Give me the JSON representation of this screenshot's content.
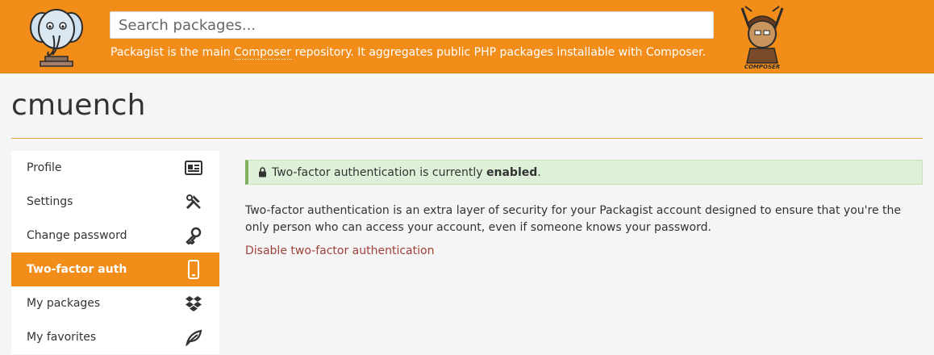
{
  "header": {
    "search_placeholder": "Search packages...",
    "tagline_before": "Packagist is the main ",
    "tagline_link": "Composer",
    "tagline_after": " repository. It aggregates public PHP packages installable with Composer.",
    "composer_logo_text": "COMPOSER",
    "brand_color": "#f28d1a"
  },
  "page": {
    "title": "cmuench"
  },
  "sidebar": {
    "items": [
      {
        "label": "Profile",
        "icon": "id-card-icon",
        "active": false
      },
      {
        "label": "Settings",
        "icon": "tools-icon",
        "active": false
      },
      {
        "label": "Change password",
        "icon": "key-icon",
        "active": false
      },
      {
        "label": "Two-factor auth",
        "icon": "mobile-phone-icon",
        "active": true
      },
      {
        "label": "My packages",
        "icon": "dropbox-icon",
        "active": false
      },
      {
        "label": "My favorites",
        "icon": "leaf-icon",
        "active": false
      }
    ]
  },
  "main": {
    "alert_text": "Two-factor authentication is currently ",
    "alert_strong": "enabled",
    "alert_end": ".",
    "description": "Two-factor authentication is an extra layer of security for your Packagist account designed to ensure that you're the only person who can access your account, even if someone knows your password.",
    "disable_link": "Disable two-factor authentication"
  }
}
